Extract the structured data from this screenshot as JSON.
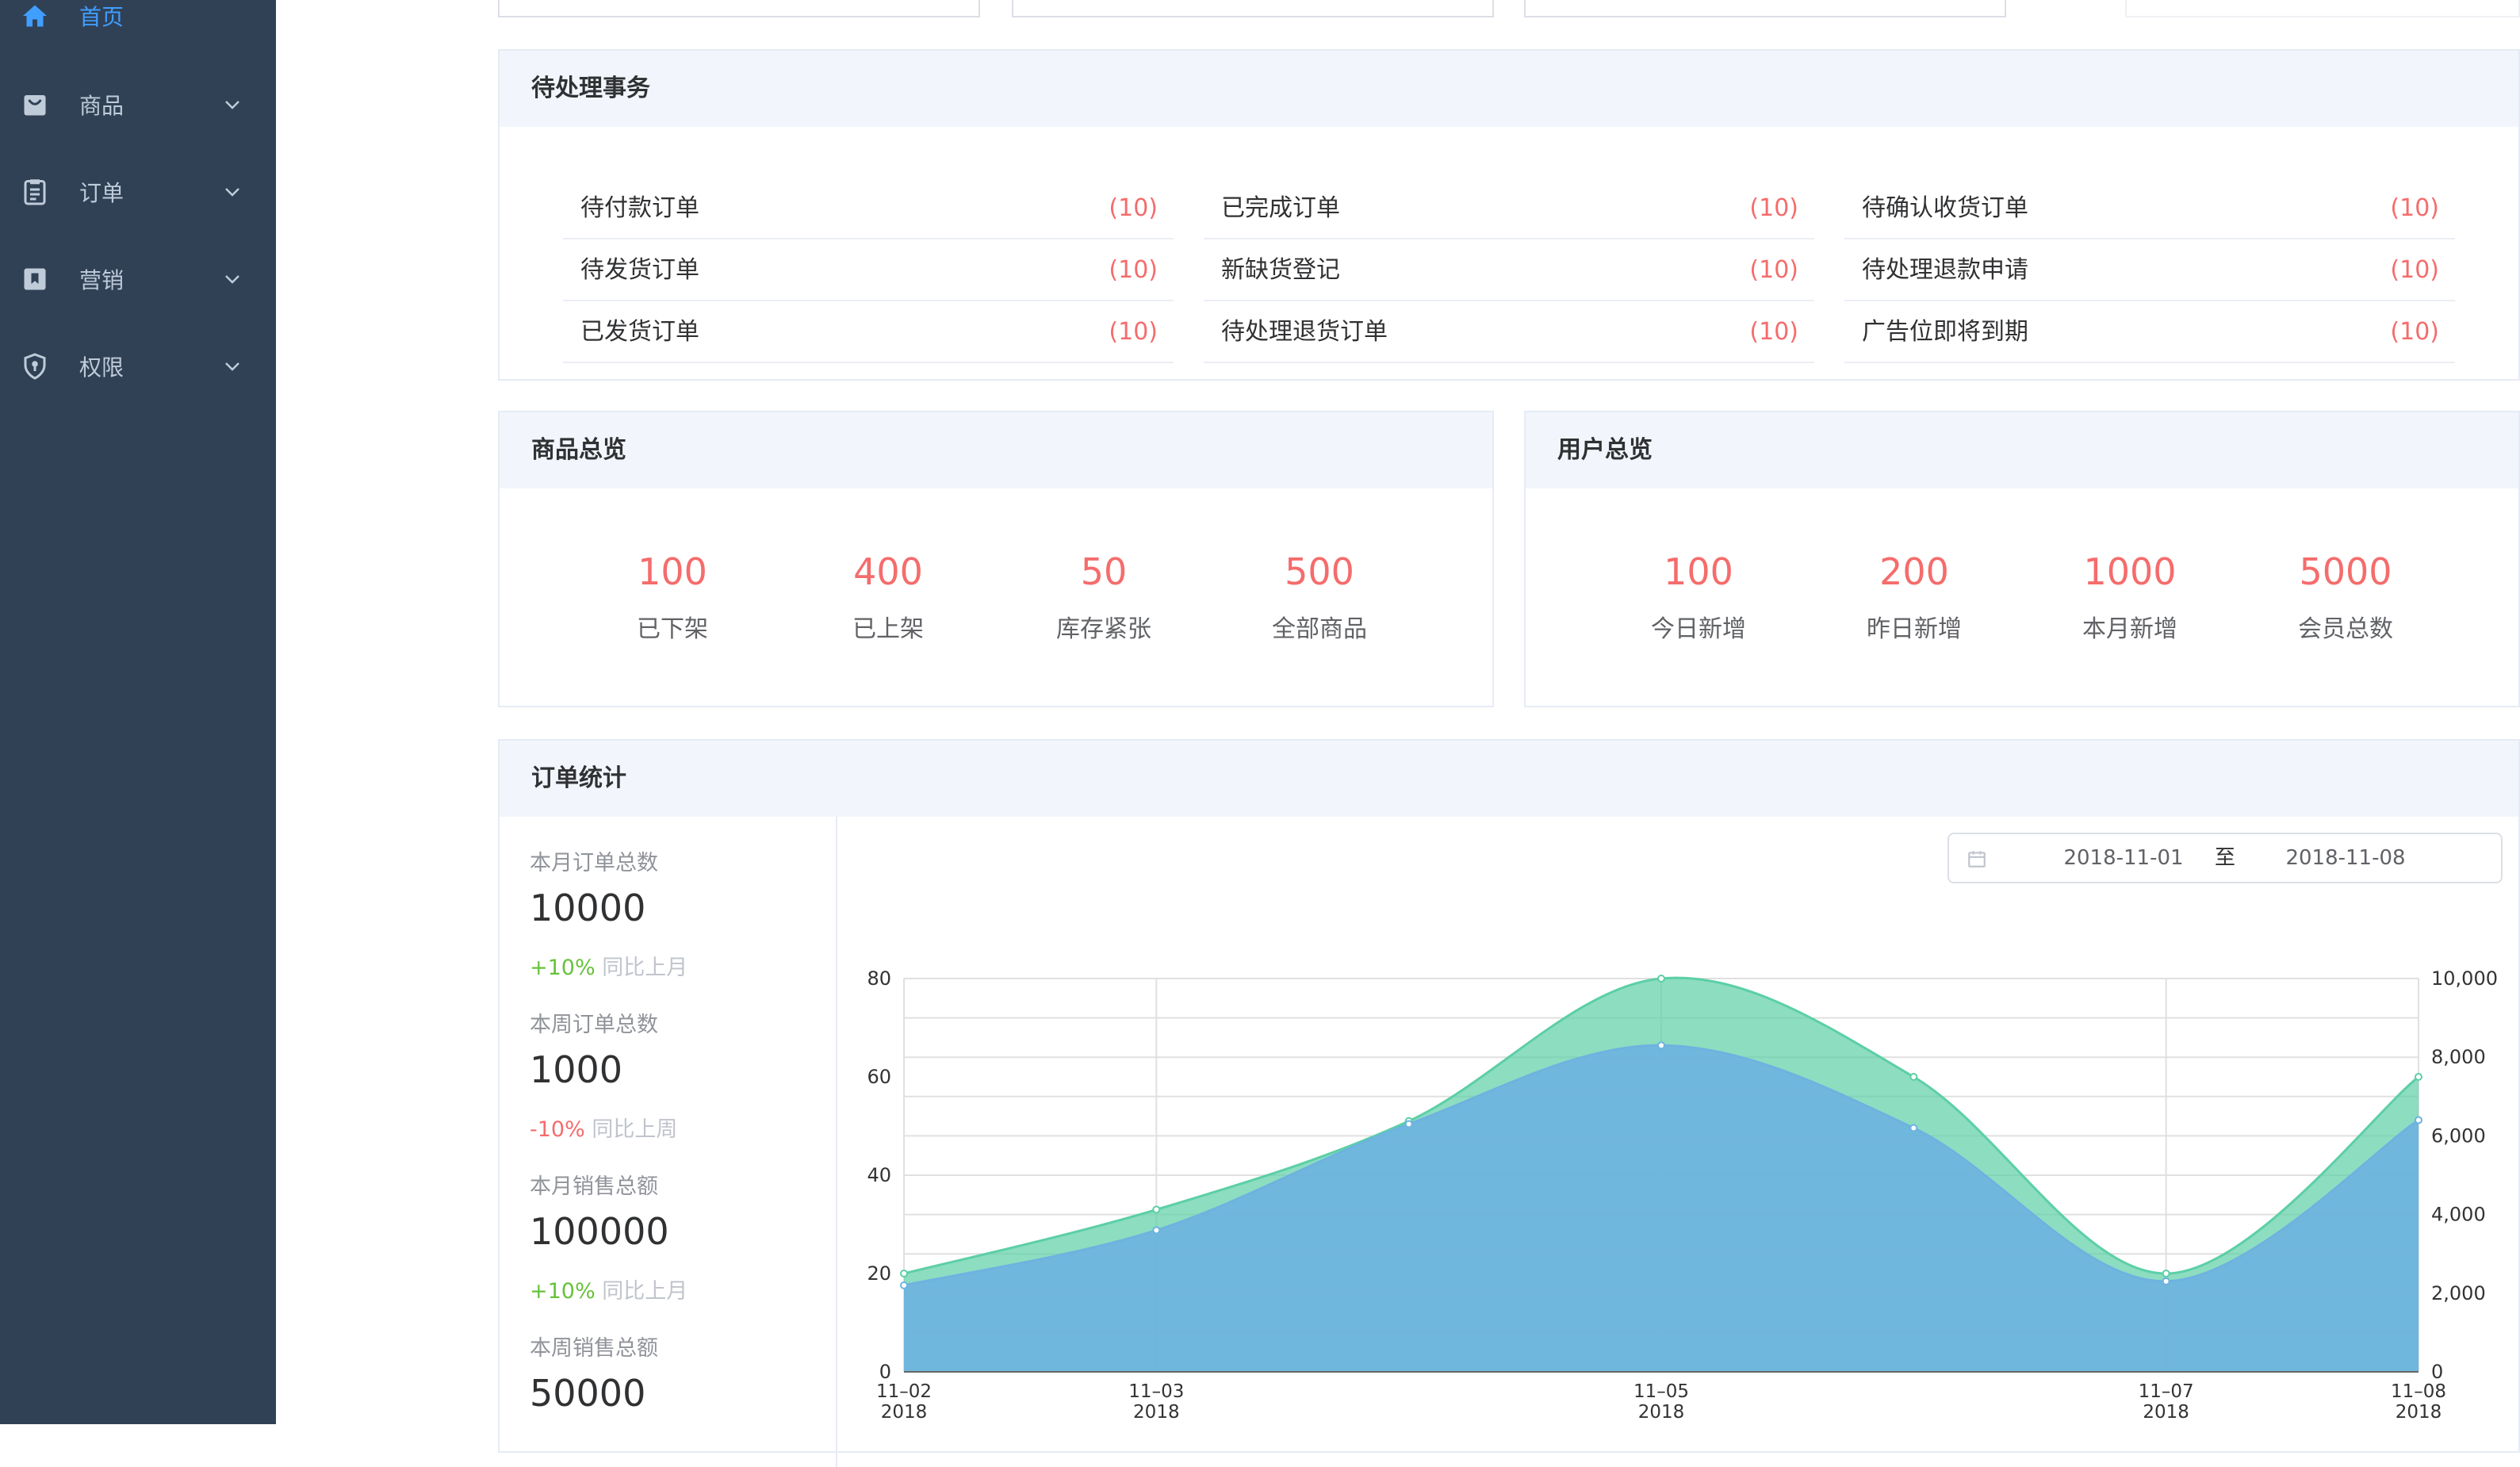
{
  "sidebar": {
    "items": [
      {
        "label": "首页",
        "icon": "home-icon",
        "active": true
      },
      {
        "label": "商品",
        "icon": "bag-icon"
      },
      {
        "label": "订单",
        "icon": "clipboard-icon"
      },
      {
        "label": "营销",
        "icon": "bookmark-icon"
      },
      {
        "label": "权限",
        "icon": "shield-icon"
      }
    ]
  },
  "pending": {
    "title": "待处理事务",
    "items": [
      {
        "label": "待付款订单",
        "count": "(10)"
      },
      {
        "label": "已完成订单",
        "count": "(10)"
      },
      {
        "label": "待确认收货订单",
        "count": "(10)"
      },
      {
        "label": "待发货订单",
        "count": "(10)"
      },
      {
        "label": "新缺货登记",
        "count": "(10)"
      },
      {
        "label": "待处理退款申请",
        "count": "(10)"
      },
      {
        "label": "已发货订单",
        "count": "(10)"
      },
      {
        "label": "待处理退货订单",
        "count": "(10)"
      },
      {
        "label": "广告位即将到期",
        "count": "(10)"
      }
    ]
  },
  "product_overview": {
    "title": "商品总览",
    "items": [
      {
        "value": "100",
        "label": "已下架"
      },
      {
        "value": "400",
        "label": "已上架"
      },
      {
        "value": "50",
        "label": "库存紧张"
      },
      {
        "value": "500",
        "label": "全部商品"
      }
    ]
  },
  "user_overview": {
    "title": "用户总览",
    "items": [
      {
        "value": "100",
        "label": "今日新增"
      },
      {
        "value": "200",
        "label": "昨日新增"
      },
      {
        "value": "1000",
        "label": "本月新增"
      },
      {
        "value": "5000",
        "label": "会员总数"
      }
    ]
  },
  "order_stats": {
    "title": "订单统计",
    "stats": [
      {
        "title": "本月订单总数",
        "value": "10000",
        "change": "+10%",
        "compare": "同比上月",
        "trend": "up"
      },
      {
        "title": "本周订单总数",
        "value": "1000",
        "change": "-10%",
        "compare": "同比上周",
        "trend": "down"
      },
      {
        "title": "本月销售总额",
        "value": "100000",
        "change": "+10%",
        "compare": "同比上月",
        "trend": "up"
      },
      {
        "title": "本周销售总额",
        "value": "50000"
      }
    ],
    "date_range": {
      "start": "2018-11-01",
      "separator": "至",
      "end": "2018-11-08",
      "icon": "calendar-icon"
    }
  },
  "colors": {
    "sidebar_bg": "#304156",
    "active": "#409EFF",
    "highlight": "#f56c6c",
    "up": "#67c23a",
    "down": "#f56c6c",
    "series_orders": "#5ccfa6",
    "series_sales": "#6db3e0"
  },
  "chart_data": {
    "type": "area",
    "x": [
      "2018-11-02",
      "2018-11-03",
      "2018-11-04",
      "2018-11-05",
      "2018-11-06",
      "2018-11-07",
      "2018-11-08"
    ],
    "x_tick_labels": [
      {
        "x": "2018-11-02",
        "line1": "11–02",
        "line2": "2018"
      },
      {
        "x": "2018-11-03",
        "line1": "11–03",
        "line2": "2018"
      },
      {
        "x": "2018-11-05",
        "line1": "11–05",
        "line2": "2018"
      },
      {
        "x": "2018-11-07",
        "line1": "11–07",
        "line2": "2018"
      },
      {
        "x": "2018-11-08",
        "line1": "11–08",
        "line2": "2018"
      }
    ],
    "series": [
      {
        "values": [
          20,
          33,
          51,
          80,
          60,
          20,
          60
        ],
        "axis": "left",
        "color": "#5ccfa6"
      },
      {
        "values": [
          2200,
          3600,
          6300,
          8300,
          6200,
          2300,
          6400
        ],
        "axis": "right",
        "color": "#6db3e0"
      }
    ],
    "ylim_left": [
      0,
      80
    ],
    "ylim_right": [
      0,
      10000
    ],
    "yticks_left": [
      0,
      20,
      40,
      60,
      80
    ],
    "yticks_right": [
      "0",
      "2,000",
      "4,000",
      "6,000",
      "8,000",
      "10,000"
    ],
    "grid": true
  }
}
